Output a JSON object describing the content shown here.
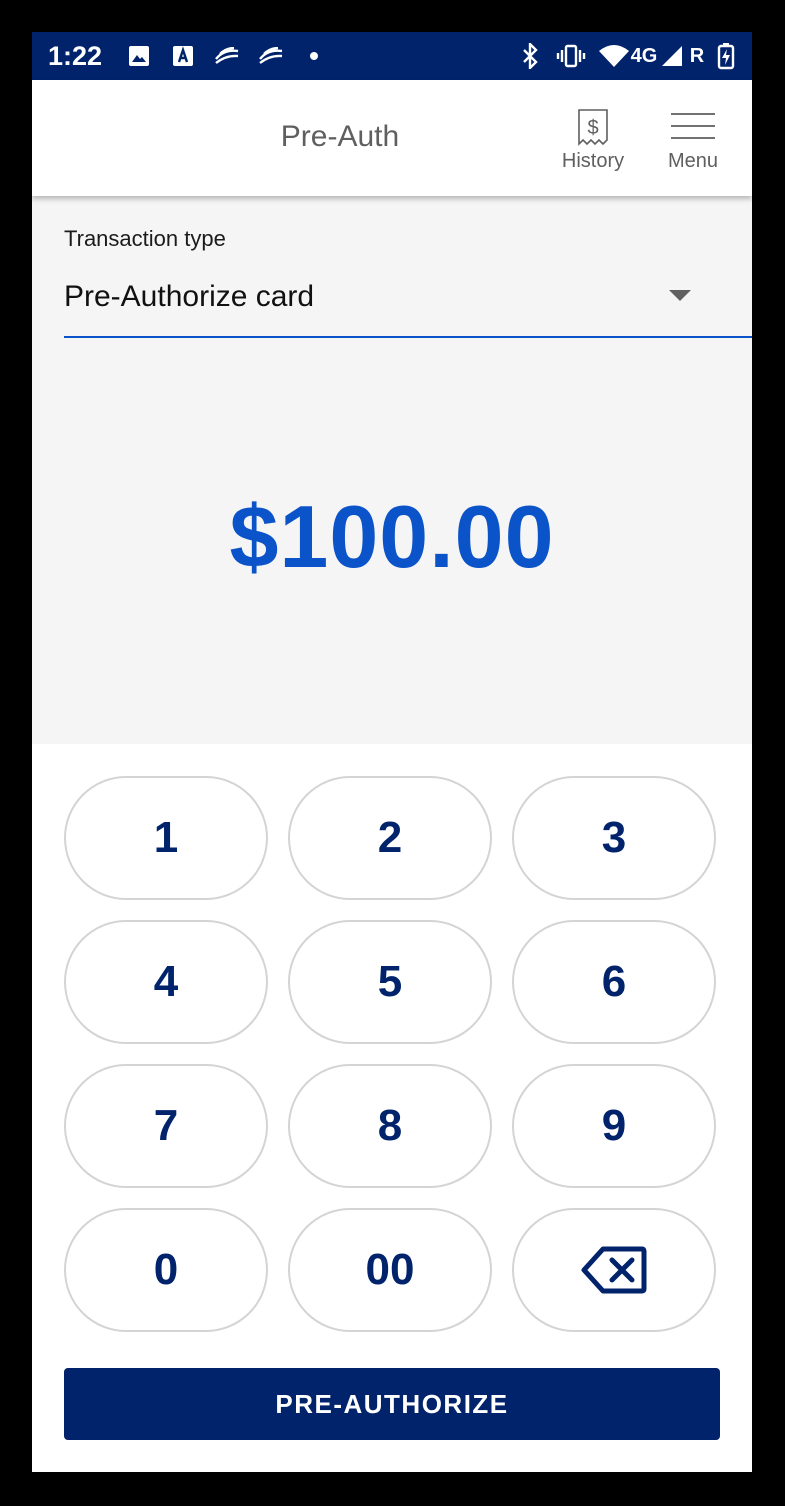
{
  "status_bar": {
    "time": "1:22",
    "network": "4G",
    "roaming": "R",
    "icons": [
      "image-icon",
      "font-icon",
      "stock-app-icon",
      "stock-app-icon",
      "notification-dot-icon",
      "bluetooth-icon",
      "vibrate-icon",
      "wifi-icon",
      "signal-icon",
      "battery-charging-icon"
    ]
  },
  "app_bar": {
    "title": "Pre-Auth",
    "history_label": "History",
    "menu_label": "Menu",
    "history_icon": "receipt-dollar-icon",
    "menu_icon": "hamburger-menu-icon"
  },
  "transaction": {
    "type_label": "Transaction type",
    "type_value": "Pre-Authorize card"
  },
  "amount": "$100.00",
  "keypad": {
    "keys": [
      "1",
      "2",
      "3",
      "4",
      "5",
      "6",
      "7",
      "8",
      "9",
      "0",
      "00"
    ],
    "backspace_icon": "backspace-icon"
  },
  "submit_label": "PRE-AUTHORIZE",
  "colors": {
    "primary_navy": "#00236b",
    "accent_blue": "#0b53c9",
    "background_gray": "#f5f5f5"
  }
}
